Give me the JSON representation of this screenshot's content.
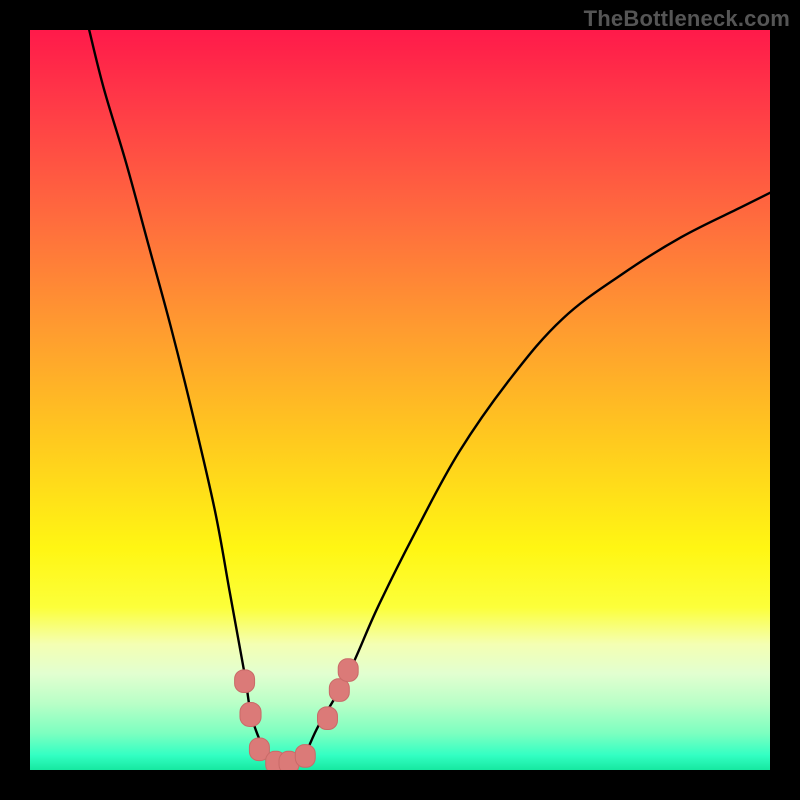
{
  "watermark": "TheBottleneck.com",
  "colors": {
    "background": "#000000",
    "curve": "#000000",
    "marker_fill": "#db7a78",
    "marker_stroke": "#c96a68",
    "gradient_stops": [
      "#ff1a4a",
      "#ff3a47",
      "#ff6a3e",
      "#ff9a30",
      "#ffc81f",
      "#fff613",
      "#fcff3a",
      "#f4ffb3",
      "#e2ffd0",
      "#b9ffc7",
      "#7dffc0",
      "#33ffc3",
      "#16e8a0"
    ]
  },
  "chart_data": {
    "type": "line",
    "title": "",
    "subtitle": "",
    "source": "TheBottleneck.com",
    "xlabel": "",
    "ylabel": "",
    "xlim": [
      0,
      100
    ],
    "ylim": [
      0,
      100
    ],
    "grid": false,
    "legend": false,
    "series": [
      {
        "name": "curve",
        "x": [
          8,
          10,
          13,
          16,
          19,
          22,
          25,
          27,
          29,
          30,
          32,
          33,
          35,
          37,
          39,
          43,
          47,
          52,
          58,
          65,
          72,
          80,
          88,
          96,
          100
        ],
        "y": [
          100,
          92,
          82,
          71,
          60,
          48,
          35,
          24,
          13,
          7,
          2,
          1,
          1,
          2,
          6,
          13,
          22,
          32,
          43,
          53,
          61,
          67,
          72,
          76,
          78
        ]
      }
    ],
    "markers": [
      {
        "x": 29.0,
        "y": 12.0,
        "r": 1.8
      },
      {
        "x": 29.8,
        "y": 7.5,
        "r": 1.9
      },
      {
        "x": 31.0,
        "y": 2.8,
        "r": 1.8
      },
      {
        "x": 33.2,
        "y": 1.0,
        "r": 1.8
      },
      {
        "x": 35.0,
        "y": 1.0,
        "r": 1.8
      },
      {
        "x": 37.2,
        "y": 1.9,
        "r": 1.8
      },
      {
        "x": 40.2,
        "y": 7.0,
        "r": 1.8
      },
      {
        "x": 41.8,
        "y": 10.8,
        "r": 1.8
      },
      {
        "x": 43.0,
        "y": 13.5,
        "r": 1.8
      }
    ]
  }
}
